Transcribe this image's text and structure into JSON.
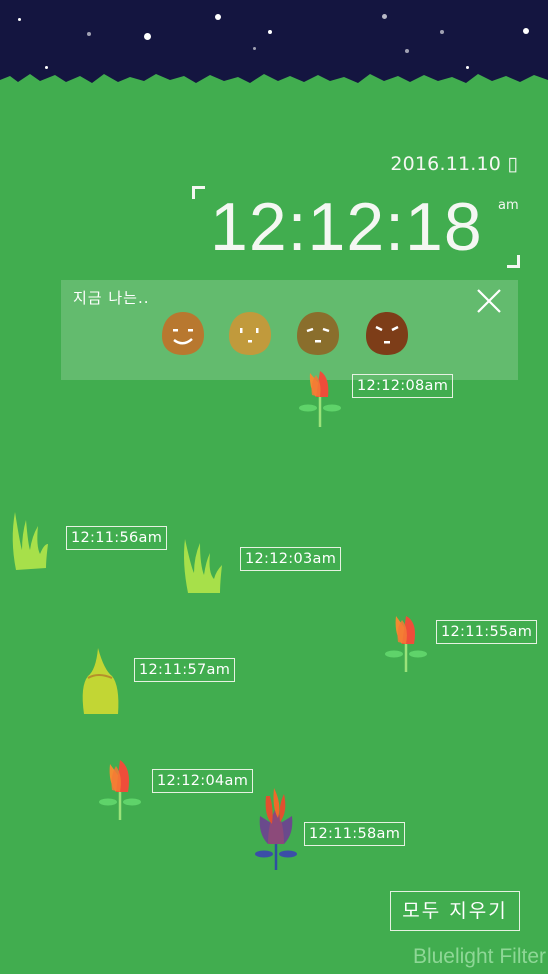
{
  "clock": {
    "date": "2016.11.10 ▯",
    "time": "12:12:18",
    "ampm": "am"
  },
  "mood_panel": {
    "title": "지금 나는..",
    "faces": [
      {
        "name": "happy",
        "color": "#b8782f"
      },
      {
        "name": "calm",
        "color": "#c19a3c"
      },
      {
        "name": "sad",
        "color": "#8a6e2c"
      },
      {
        "name": "angry",
        "color": "#7d3d18"
      }
    ]
  },
  "entries": [
    {
      "time": "12:12:08am",
      "plant": "tulip"
    },
    {
      "time": "12:11:56am",
      "plant": "grass"
    },
    {
      "time": "12:12:03am",
      "plant": "grass"
    },
    {
      "time": "12:11:55am",
      "plant": "tulip"
    },
    {
      "time": "12:11:57am",
      "plant": "sprout"
    },
    {
      "time": "12:12:04am",
      "plant": "tulip"
    },
    {
      "time": "12:11:58am",
      "plant": "fire-flower"
    }
  ],
  "clear_button": "모두 지우기",
  "watermark": "Bluelight Filter"
}
